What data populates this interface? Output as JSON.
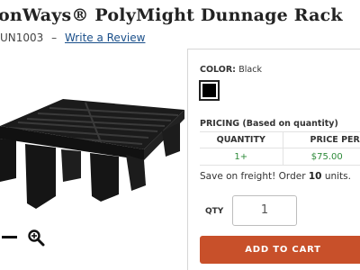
{
  "product": {
    "title": "onWays® PolyMight Dunnage Rack",
    "sku": "UN1003",
    "separator": "–",
    "review_link": "Write a Review"
  },
  "image": {
    "icons": [
      "minus-icon",
      "magnifier-icon"
    ]
  },
  "options": {
    "color_label": "COLOR:",
    "color_value": "Black",
    "swatch_color": "#000000"
  },
  "pricing": {
    "label": "PRICING (Based on quantity)",
    "headers": [
      "QUANTITY",
      "PRICE PER U"
    ],
    "rows": [
      {
        "quantity": "1+",
        "price": "$75.00"
      }
    ]
  },
  "freight": {
    "prefix": "Save on freight! Order ",
    "units": "10",
    "suffix": " units."
  },
  "cart": {
    "qty_label": "QTY",
    "qty_value": "1",
    "add_label": "ADD TO CART"
  },
  "colors": {
    "accent": "#c8502a",
    "link": "#1a4f8a",
    "price_green": "#2e8b3a"
  }
}
